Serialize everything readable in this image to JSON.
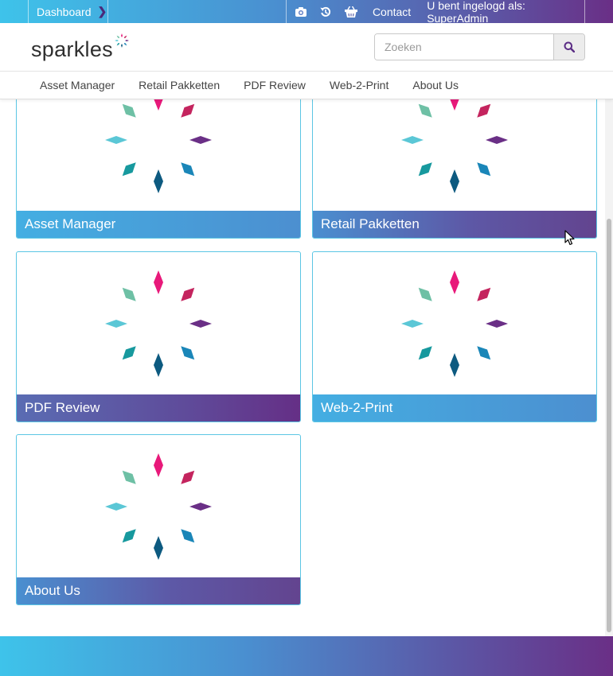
{
  "topbar": {
    "dashboard_label": "Dashboard",
    "contact_label": "Contact",
    "logged_in_text": "U bent ingelogd als: SuperAdmin",
    "icons": [
      "camera-icon",
      "history-icon",
      "basket-icon"
    ]
  },
  "header": {
    "logo_text": "sparkles",
    "search_placeholder": "Zoeken"
  },
  "nav": {
    "items": [
      {
        "label": "Asset Manager"
      },
      {
        "label": "Retail Pakketten"
      },
      {
        "label": "PDF Review"
      },
      {
        "label": "Web-2-Print"
      },
      {
        "label": "About Us"
      }
    ]
  },
  "tiles": [
    {
      "label": "Asset Manager"
    },
    {
      "label": "Retail Pakketten"
    },
    {
      "label": "PDF Review"
    },
    {
      "label": "Web-2-Print"
    },
    {
      "label": "About Us"
    }
  ],
  "colors": {
    "gradient_start": "#3ec3ea",
    "gradient_end": "#6a2f86",
    "tile_border": "#5bc6e4"
  }
}
